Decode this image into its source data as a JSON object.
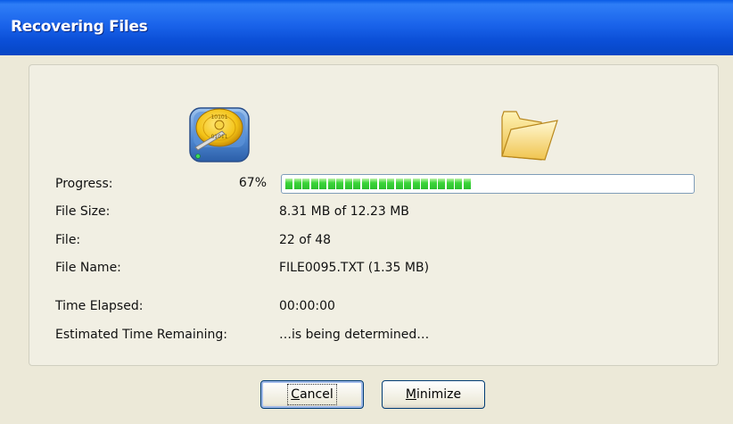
{
  "window": {
    "title": "Recovering Files"
  },
  "progress": {
    "label": "Progress:",
    "percent_text": "67%",
    "fraction": 0.67,
    "blocks": 22,
    "total_blocks": 33
  },
  "rows": {
    "file_size": {
      "label": "File Size:",
      "value": "8.31 MB of 12.23 MB"
    },
    "file": {
      "label": "File:",
      "value": "22 of 48"
    },
    "file_name": {
      "label": "File Name:",
      "value": "FILE0095.TXT (1.35 MB)"
    },
    "time_elapsed": {
      "label": "Time Elapsed:",
      "value": "00:00:00"
    },
    "time_remaining": {
      "label": "Estimated Time Remaining:",
      "value": "…is being determined…"
    }
  },
  "buttons": {
    "cancel": {
      "mnemonic": "C",
      "rest": "ancel"
    },
    "minimize": {
      "mnemonic": "M",
      "rest": "inimize"
    }
  },
  "icons": {
    "drive": "hard-drive-icon",
    "folder": "folder-icon",
    "drive_sticker_top": "10101",
    "drive_sticker_bottom": "01011"
  },
  "colors": {
    "titlebar": "#0a5ce6",
    "progress_fill": "#3cd53a",
    "window_bg": "#ece9d8"
  }
}
